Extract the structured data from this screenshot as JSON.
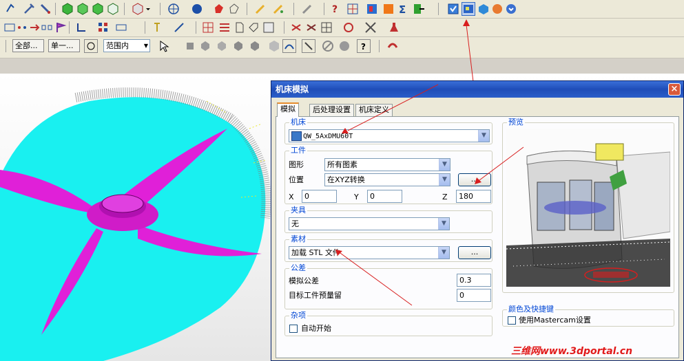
{
  "toolbar_row3": {
    "combo_all": "全部...",
    "combo_single": "单一...",
    "combo_range": "范围内"
  },
  "dialog": {
    "title": "机床模拟",
    "close_symbol": "×",
    "tabs": [
      "模拟",
      "后处理设置",
      "机床定义"
    ],
    "machine": {
      "label": "机床",
      "value": "QW_5AxDMU60T"
    },
    "workpiece": {
      "label": "工件",
      "shape_label": "图形",
      "shape_value": "所有图素",
      "position_label": "位置",
      "position_value": "在XYZ转换",
      "dots": "...",
      "x_label": "X",
      "x_value": "0",
      "y_label": "Y",
      "y_value": "0",
      "z_label": "Z",
      "z_value": "180"
    },
    "fixture": {
      "label": "夹具",
      "value": "无"
    },
    "stock": {
      "label": "素材",
      "value": "加载 STL 文件",
      "dots": "..."
    },
    "tolerance": {
      "label": "公差",
      "sim_tol_label": "模拟公差",
      "sim_tol_value": "0.3",
      "target_stock_label": "目标工件预量留",
      "target_stock_value": "0"
    },
    "misc": {
      "label": "杂项",
      "auto_start_label": "自动开始"
    },
    "preview": {
      "label": "预览"
    },
    "colors": {
      "label": "颜色及快捷键",
      "use_mastercam_label": "使用Mastercam设置"
    }
  },
  "watermark": "三维网www.3dportal.cn",
  "colors": {
    "cyan": "#19f0f0",
    "magenta": "#e020d8",
    "accent_red": "#d81e1e",
    "title_blue": "#1f4db8"
  }
}
